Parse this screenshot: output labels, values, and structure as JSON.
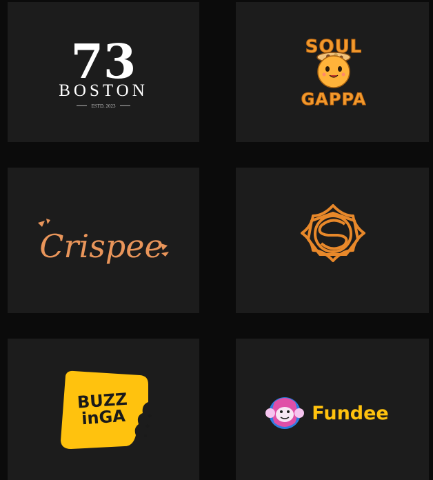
{
  "logos": [
    {
      "name": "73 Boston",
      "mark": "73",
      "word": "BOSTON",
      "tag": "ESTD. 2023",
      "color": "#ffffff"
    },
    {
      "name": "Soul Gappa",
      "line1": "SOUL",
      "line2": "GAPPA",
      "color": "#f29a2e"
    },
    {
      "name": "Crispee",
      "word": "Crispee",
      "color": "#e9955a"
    },
    {
      "name": "Lotus S emblem",
      "color": "#e8882a"
    },
    {
      "name": "Buzzinga",
      "line1": "BUZZ",
      "line2": "inGA",
      "bg": "#ffc20e",
      "color": "#1a1a1a"
    },
    {
      "name": "Fundee",
      "word": "Fundee",
      "color": "#ffc20e"
    }
  ],
  "colors": {
    "page_bg": "#0b0b0b",
    "card_bg": "#1c1c1c"
  }
}
